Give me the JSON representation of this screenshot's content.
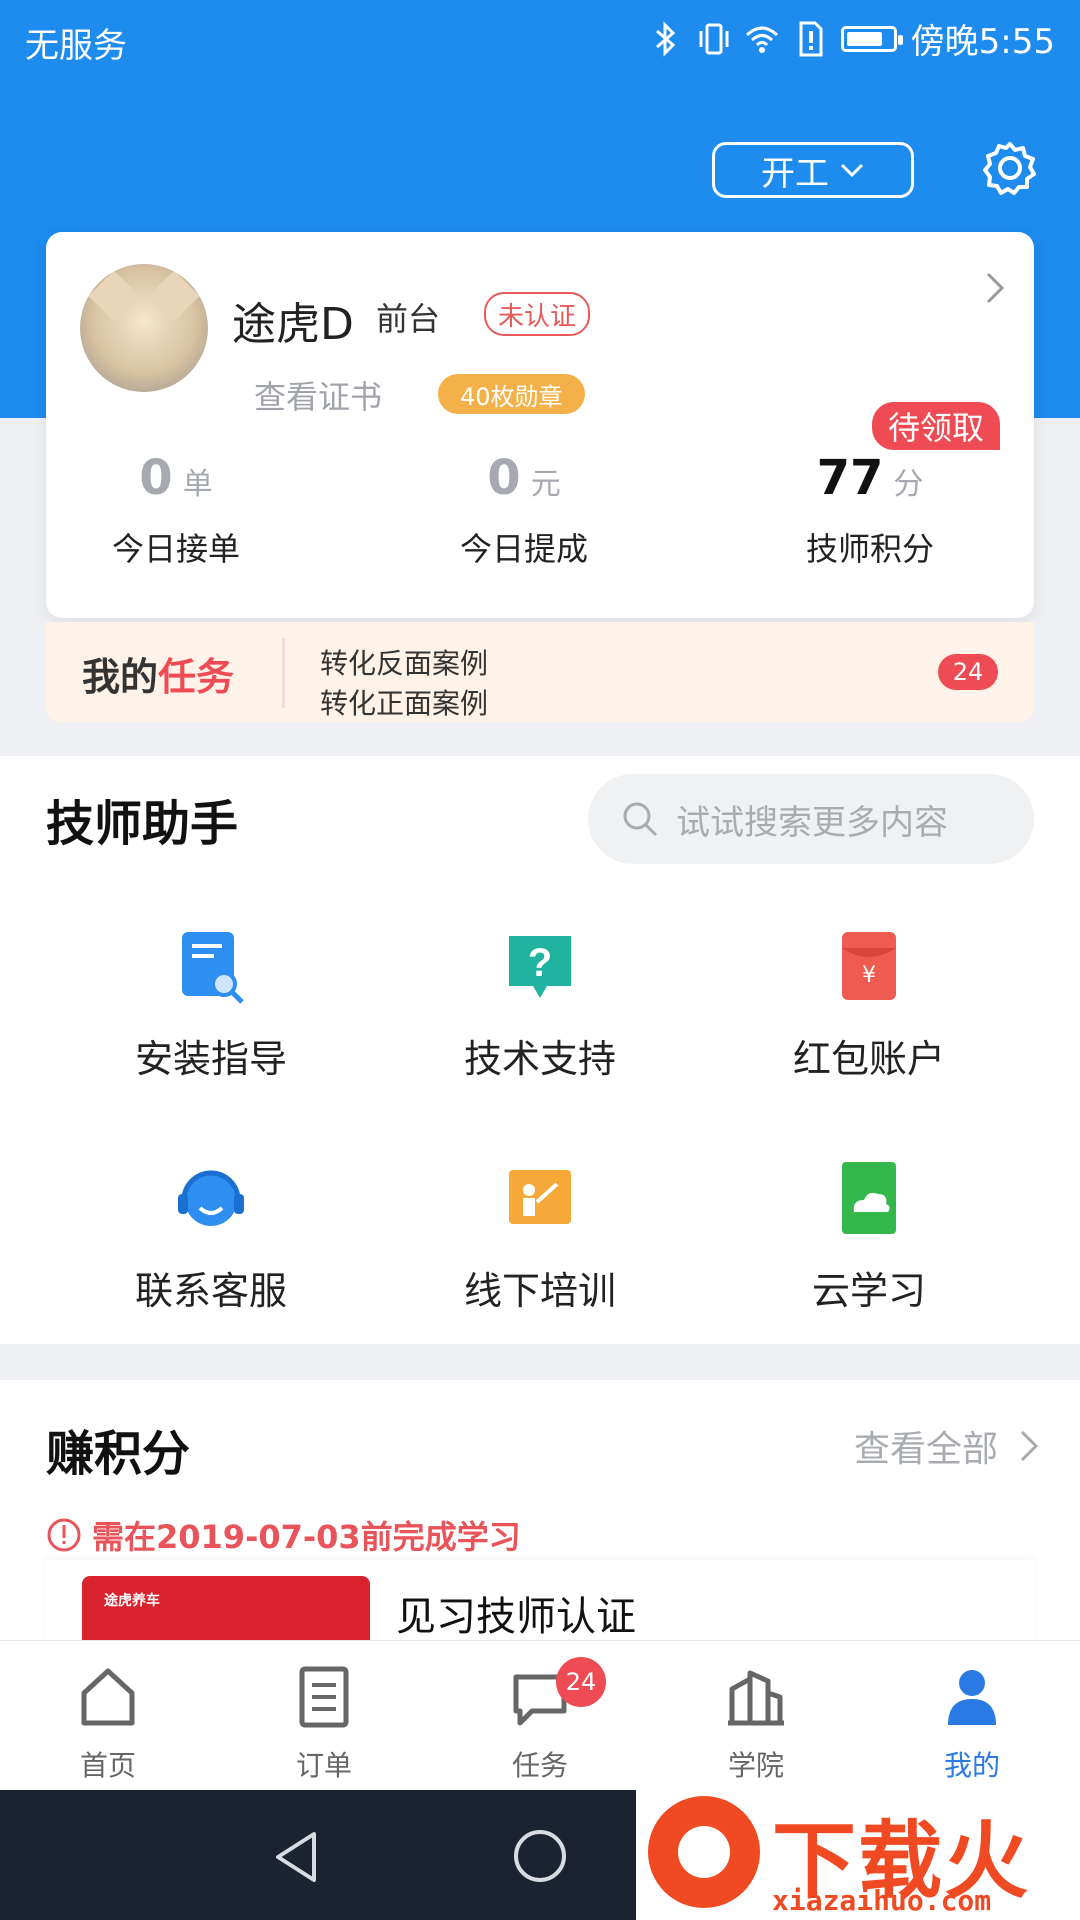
{
  "status_bar": {
    "carrier": "无服务",
    "time": "傍晚5:55",
    "battery_level": 0.7
  },
  "header": {
    "work_status": "开工"
  },
  "profile": {
    "name": "途虎D",
    "role": "前台",
    "cert_status": "未认证",
    "cert_link": "查看证书",
    "medals": "40枚勋章",
    "pending_tag": "待领取",
    "stats": [
      {
        "value": "0",
        "unit": "单",
        "label": "今日接单"
      },
      {
        "value": "0",
        "unit": "元",
        "label": "今日提成"
      },
      {
        "value": "77",
        "unit": "分",
        "label": "技师积分"
      }
    ]
  },
  "tasks": {
    "title_prefix": "我的",
    "title_highlight": "任务",
    "ticker": [
      "转化反面案例",
      "转化正面案例"
    ],
    "count": "24"
  },
  "assistant": {
    "title": "技师助手",
    "search_placeholder": "试试搜索更多内容",
    "items": [
      {
        "label": "安装指导",
        "icon": "install-guide-icon",
        "color": "#2f8ff0"
      },
      {
        "label": "技术支持",
        "icon": "question-chat-icon",
        "color": "#1fb3a0"
      },
      {
        "label": "红包账户",
        "icon": "red-envelope-icon",
        "color": "#ef5b50"
      },
      {
        "label": "联系客服",
        "icon": "headset-icon",
        "color": "#2f8ff0"
      },
      {
        "label": "线下培训",
        "icon": "teacher-board-icon",
        "color": "#f6a938"
      },
      {
        "label": "云学习",
        "icon": "cloud-book-icon",
        "color": "#34b84c"
      }
    ]
  },
  "earn": {
    "title": "赚积分",
    "view_all": "查看全部",
    "deadline": "需在2019-07-03前完成学习",
    "course_thumb_text": "途虎养车",
    "course_title": "见习技师认证"
  },
  "tabbar": {
    "items": [
      {
        "label": "首页",
        "icon": "home-icon"
      },
      {
        "label": "订单",
        "icon": "order-list-icon"
      },
      {
        "label": "任务",
        "icon": "chat-bubble-icon",
        "badge": "24"
      },
      {
        "label": "学院",
        "icon": "academy-building-icon"
      },
      {
        "label": "我的",
        "icon": "person-icon"
      }
    ],
    "active_color": "#2a7ae4"
  },
  "watermark": {
    "text": "下载火",
    "url": "xiazaihuo.com"
  },
  "colors": {
    "primary": "#1e8bef",
    "accent_red": "#ef4b55",
    "medal_orange": "#f5b149"
  }
}
